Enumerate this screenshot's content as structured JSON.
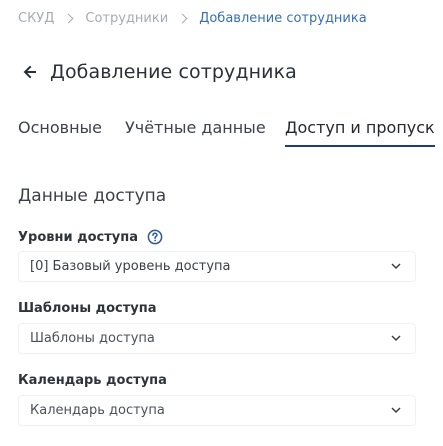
{
  "breadcrumb": {
    "items": [
      "СКУД",
      "Сотрудники",
      "Добавление сотрудника"
    ]
  },
  "header": {
    "title": "Добавление сотрудника",
    "back_icon": "arrow-left-icon"
  },
  "tabs": [
    {
      "label": "Основные",
      "active": false
    },
    {
      "label": "Учётные данные",
      "active": false
    },
    {
      "label": "Доступ и пропуск",
      "active": true
    }
  ],
  "section": {
    "title": "Данные доступа",
    "fields": [
      {
        "label": "Уровни доступа",
        "value": "[0] Базовый уровень доступа",
        "has_help": true
      },
      {
        "label": "Шаблоны доступа",
        "placeholder": "Шаблоны доступа"
      },
      {
        "label": "Календарь доступа",
        "placeholder": "Календарь доступа"
      }
    ]
  },
  "colors": {
    "accent": "#1f3f6e",
    "breadcrumb_current": "#3a6fb0",
    "help_icon": "#2d5a96"
  }
}
